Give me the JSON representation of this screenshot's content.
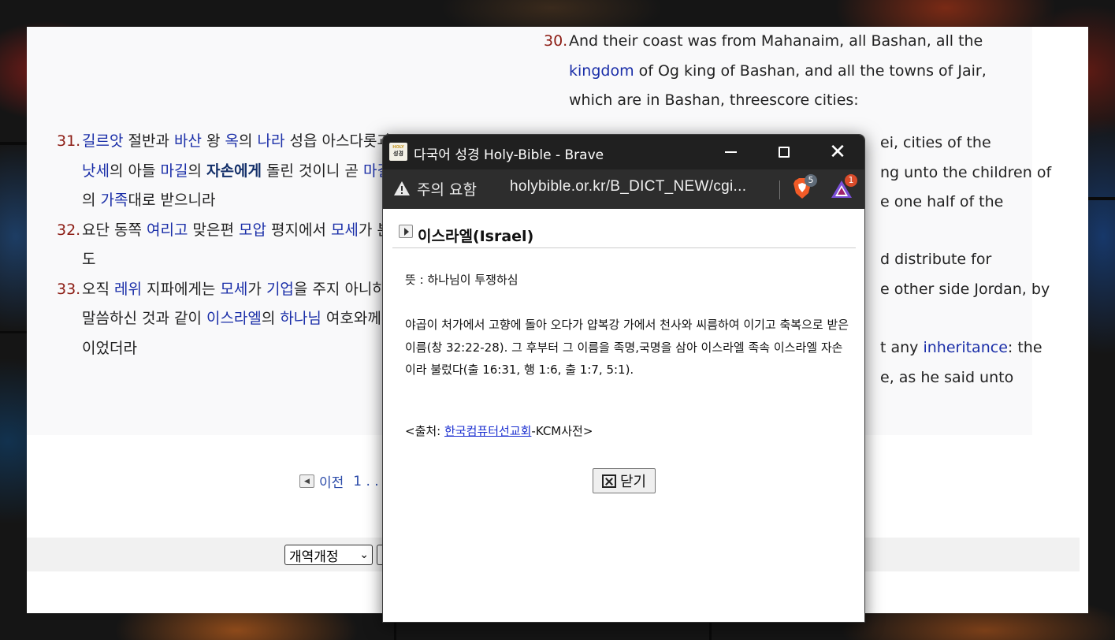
{
  "left_column": {
    "verses": [
      {
        "num": "31.",
        "lines_html": [
          [
            "길르앗",
            " 절반과 ",
            "바산",
            " 왕 ",
            "옥",
            "의 ",
            "나라",
            " 성읍 아스다롯과"
          ],
          [
            "낫세",
            "의 아들 ",
            "마길",
            "의 ",
            "자손에게",
            " 돌린 것이니 곧 ",
            "마길"
          ],
          [
            "의 ",
            "가족",
            "대로 받으니라"
          ]
        ]
      },
      {
        "num": "32.",
        "lines_html": [
          [
            "요단 동쪽 ",
            "여리고",
            " 맞은편 ",
            "모압",
            " 평지에서 ",
            "모세",
            "가 분배"
          ],
          [
            "도"
          ]
        ]
      },
      {
        "num": "33.",
        "lines_html": [
          [
            "오직 ",
            "레위",
            " 지파에게는 ",
            "모세",
            "가 ",
            "기업",
            "을 주지 아니하였"
          ],
          [
            "말씀하신 것과 같이 ",
            "이스라엘",
            "의 ",
            "하나님",
            " 여호와께서"
          ],
          [
            "이었더라"
          ]
        ]
      }
    ]
  },
  "right_column": {
    "verse30_num": "30.",
    "verse30_line1": "And their coast was from Mahanaim, all Bashan, all the",
    "verse30_link": "kingdom",
    "verse30_line2_rest": " of Og king of Bashan, and all the towns of Jair,",
    "verse30_line3": "which are in Bashan, threescore cities:",
    "frag_1": "ei, cities of the",
    "frag_2": "ng unto the children of",
    "frag_3": "e one half of the",
    "frag_4": "d distribute for",
    "frag_5": "e other side Jordan, by",
    "frag_6a": "t any ",
    "frag_6_link": "inheritance",
    "frag_6b": ": the",
    "frag_7": "e, as he said unto"
  },
  "pager": {
    "prev": "이전",
    "page": "1 . ."
  },
  "bottom_bar": {
    "version_select": "개역개정"
  },
  "popup": {
    "window_title": "다국어 성경 Holy-Bible - Brave",
    "app_icon_small": "HOLY",
    "app_icon_text": "성경",
    "warning_text": "주의 요함",
    "url": "holybible.or.kr/B_DICT_NEW/cgi...",
    "brave_badge": "5",
    "rewards_badge": "1",
    "entry_title": "이스라엘(Israel)",
    "meaning": "뜻 : 하나님이 투쟁하심",
    "description": "야곱이 처가에서 고향에 돌아 오다가 얍복강 가에서 천사와 씨름하여 이기고 축복으로 받은 이름(창 32:22-28). 그 후부터 그 이름을 족명,국명을 삼아 이스라엘 족속 이스라엘 자손이라 불렀다(출 16:31, 행 1:6, 출 1:7, 5:1).",
    "source_prefix": "<출처: ",
    "source_link": "한국컴퓨터선교회",
    "source_suffix": "-KCM사전>",
    "close_label": "닫기"
  },
  "colors": {
    "link": "#1a2ea8",
    "verse_number": "#8c1c13",
    "titlebar": "#202020"
  }
}
